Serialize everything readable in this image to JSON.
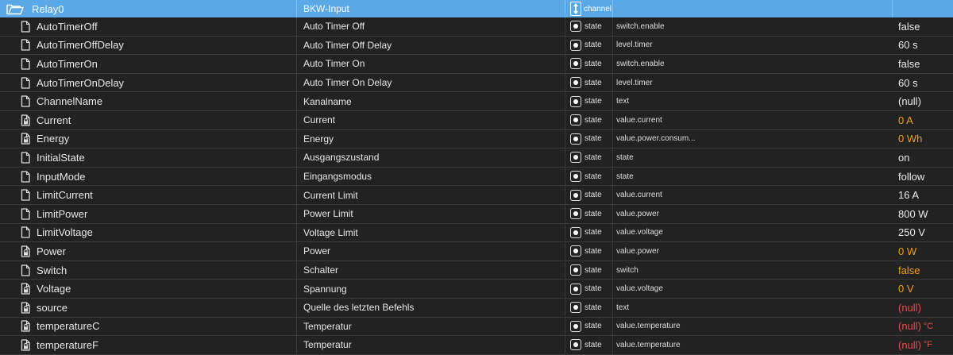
{
  "colors": {
    "header_bg": "#5aa9e6",
    "value_default": "#eaeaea",
    "value_orange": "#f39c1f",
    "value_red": "#d9534f"
  },
  "channel": {
    "name": "Relay0",
    "title": "BKW-Input",
    "type": "channel",
    "icon": "folder-open-icon"
  },
  "rows": [
    {
      "name": "AutoTimerOff",
      "title": "Auto Timer Off",
      "type": "state",
      "role": "switch.enable",
      "value": "false",
      "unit": "",
      "color": "white",
      "icon": "file-icon"
    },
    {
      "name": "AutoTimerOffDelay",
      "title": "Auto Timer Off Delay",
      "type": "state",
      "role": "level.timer",
      "value": "60 s",
      "unit": "",
      "color": "white",
      "icon": "file-icon"
    },
    {
      "name": "AutoTimerOn",
      "title": "Auto Timer On",
      "type": "state",
      "role": "switch.enable",
      "value": "false",
      "unit": "",
      "color": "white",
      "icon": "file-icon"
    },
    {
      "name": "AutoTimerOnDelay",
      "title": "Auto Timer On Delay",
      "type": "state",
      "role": "level.timer",
      "value": "60 s",
      "unit": "",
      "color": "white",
      "icon": "file-icon"
    },
    {
      "name": "ChannelName",
      "title": "Kanalname",
      "type": "state",
      "role": "text",
      "value": "(null)",
      "unit": "",
      "color": "white",
      "icon": "file-icon"
    },
    {
      "name": "Current",
      "title": "Current",
      "type": "state",
      "role": "value.current",
      "value": "0 A",
      "unit": "",
      "color": "orange",
      "icon": "file-readonly-icon"
    },
    {
      "name": "Energy",
      "title": "Energy",
      "type": "state",
      "role": "value.power.consum...",
      "value": "0 Wh",
      "unit": "",
      "color": "orange",
      "icon": "file-readonly-icon"
    },
    {
      "name": "InitialState",
      "title": "Ausgangszustand",
      "type": "state",
      "role": "state",
      "value": "on",
      "unit": "",
      "color": "white",
      "icon": "file-icon"
    },
    {
      "name": "InputMode",
      "title": "Eingangsmodus",
      "type": "state",
      "role": "state",
      "value": "follow",
      "unit": "",
      "color": "white",
      "icon": "file-icon"
    },
    {
      "name": "LimitCurrent",
      "title": "Current Limit",
      "type": "state",
      "role": "value.current",
      "value": "16 A",
      "unit": "",
      "color": "white",
      "icon": "file-icon"
    },
    {
      "name": "LimitPower",
      "title": "Power Limit",
      "type": "state",
      "role": "value.power",
      "value": "800 W",
      "unit": "",
      "color": "white",
      "icon": "file-icon"
    },
    {
      "name": "LimitVoltage",
      "title": "Voltage Limit",
      "type": "state",
      "role": "value.voltage",
      "value": "250 V",
      "unit": "",
      "color": "white",
      "icon": "file-icon"
    },
    {
      "name": "Power",
      "title": "Power",
      "type": "state",
      "role": "value.power",
      "value": "0 W",
      "unit": "",
      "color": "orange",
      "icon": "file-readonly-icon"
    },
    {
      "name": "Switch",
      "title": "Schalter",
      "type": "state",
      "role": "switch",
      "value": "false",
      "unit": "",
      "color": "orange",
      "icon": "file-icon"
    },
    {
      "name": "Voltage",
      "title": "Spannung",
      "type": "state",
      "role": "value.voltage",
      "value": "0 V",
      "unit": "",
      "color": "orange",
      "icon": "file-readonly-icon"
    },
    {
      "name": "source",
      "title": "Quelle des letzten Befehls",
      "type": "state",
      "role": "text",
      "value": "(null)",
      "unit": "",
      "color": "red",
      "icon": "file-readonly-icon"
    },
    {
      "name": "temperatureC",
      "title": "Temperatur",
      "type": "state",
      "role": "value.temperature",
      "value": "(null)",
      "unit": "°C",
      "color": "red",
      "icon": "file-readonly-icon"
    },
    {
      "name": "temperatureF",
      "title": "Temperatur",
      "type": "state",
      "role": "value.temperature",
      "value": "(null)",
      "unit": "°F",
      "color": "red",
      "icon": "file-readonly-icon"
    }
  ]
}
